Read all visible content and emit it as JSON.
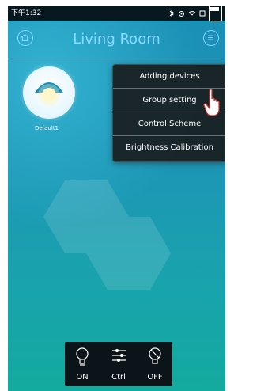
{
  "status_bar": {
    "time": "下午1:32"
  },
  "header": {
    "title": "Living Room"
  },
  "device": {
    "name": "Default1"
  },
  "menu": {
    "items": [
      {
        "label": "Adding devices"
      },
      {
        "label": "Group setting"
      },
      {
        "label": "Control Scheme"
      },
      {
        "label": "Brightness Calibration"
      }
    ]
  },
  "controls": {
    "on_label": "ON",
    "ctrl_label": "Ctrl",
    "off_label": "OFF"
  },
  "icons": {
    "home": "home-icon",
    "menu": "menu-icon",
    "bulb_on": "bulb-on-icon",
    "ctrl": "sliders-icon",
    "bulb_off": "bulb-off-icon",
    "lamp": "lamp-icon",
    "cursor": "hand-cursor-icon"
  },
  "colors": {
    "header_accent": "#8bd8ff",
    "screen_top": "#1b8fb6",
    "screen_bottom": "#13aa9f",
    "menu_bg": "#192022",
    "bottom_bar_bg": "#0b1418"
  }
}
